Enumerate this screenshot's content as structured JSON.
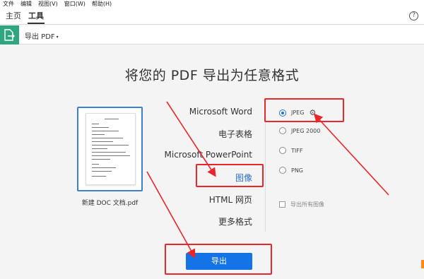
{
  "menubar": [
    "文件",
    "编辑",
    "视图(V)",
    "窗口(W)",
    "帮助(H)"
  ],
  "tabs": {
    "home": "主页",
    "tools": "工具"
  },
  "help_icon": "?",
  "toolbar": {
    "label": "导出 PDF",
    "caret": "▾"
  },
  "title": "将您的 PDF 导出为任意格式",
  "document": {
    "filename": "新建 DOC 文档.pdf"
  },
  "formats": [
    "Microsoft Word",
    "电子表格",
    "Microsoft PowerPoint",
    "图像",
    "HTML 网页",
    "更多格式"
  ],
  "selected_format": "图像",
  "options": {
    "jpeg": "JPEG",
    "jpeg2000": "JPEG 2000",
    "tiff": "TIFF",
    "png": "PNG",
    "export_all_images": "导出所有图像"
  },
  "selected_option": "JPEG",
  "export_button": "导出",
  "colors": {
    "accent": "#1473e6",
    "tool_icon_bg": "#2fa67f",
    "annotation_red": "#e8262b",
    "selected_format": "#2a6fc9"
  },
  "icons": {
    "tool": "export-pdf-icon",
    "settings": "gear-icon",
    "help": "help-icon"
  }
}
